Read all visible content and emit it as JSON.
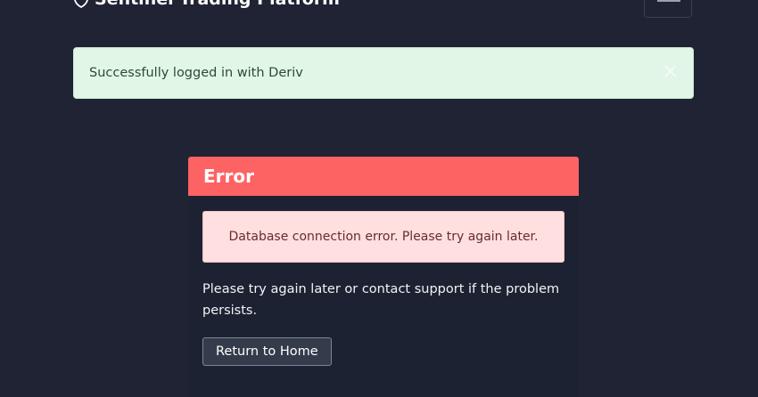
{
  "navbar": {
    "brand": "Sentinel Trading Platform"
  },
  "flash": {
    "message": "Successfully logged in with Deriv",
    "close": "×"
  },
  "error_card": {
    "title": "Error",
    "alert": "Database connection error. Please try again later.",
    "message": "Please try again later or contact support if the problem persists.",
    "button": "Return to Home"
  },
  "colors": {
    "background": "#1f2333",
    "error_header": "#fe6363",
    "success_bg": "#e1f6e6",
    "danger_bg": "#ffdfe0"
  }
}
